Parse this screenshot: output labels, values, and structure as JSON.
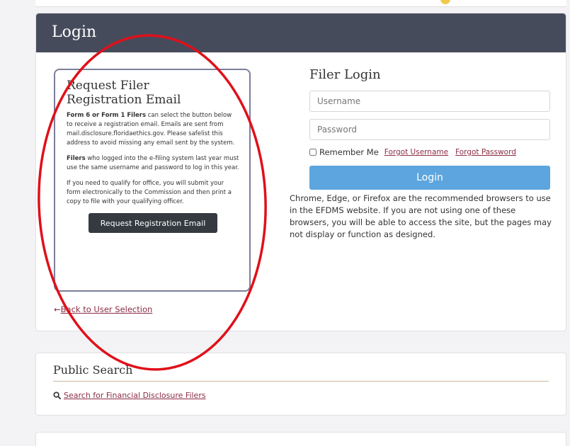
{
  "login": {
    "header": "Login",
    "request_box": {
      "title": "Request Filer Registration Email",
      "para1_bold": "Form 6 or Form 1 Filers",
      "para1_rest": " can select the button below to receive a registration email. Emails are sent from mail.disclosure.floridaethics.gov. Please safelist this address to avoid missing any email sent by the system.",
      "para2_bold": "Filers",
      "para2_rest": " who logged into the e-filing system last year must use the same username and password to log in this year.",
      "para3": "If you need to qualify for office, you will submit your form electronically to the Commission and then print a copy to file with your qualifying officer.",
      "button": "Request Registration Email"
    },
    "back_link": "Back to User Selection",
    "filer": {
      "title": "Filer Login",
      "username_placeholder": "Username",
      "password_placeholder": "Password",
      "remember_label": "Remember Me",
      "forgot_username": "Forgot Username",
      "forgot_password": "Forgot Password",
      "login_button": "Login",
      "browser_note": "Chrome, Edge, or Firefox are the recommended browsers to use in the EFDMS website. If you are not using one of these browsers, you will be able to access the site, but the pages may not display or function as designed."
    }
  },
  "public_search": {
    "title": "Public Search",
    "link": "Search for Financial Disclosure Filers"
  },
  "colors": {
    "header_bg": "#464b5c",
    "login_button": "#5da5de",
    "link": "#8b2d45",
    "annotation": "#e0101a"
  }
}
